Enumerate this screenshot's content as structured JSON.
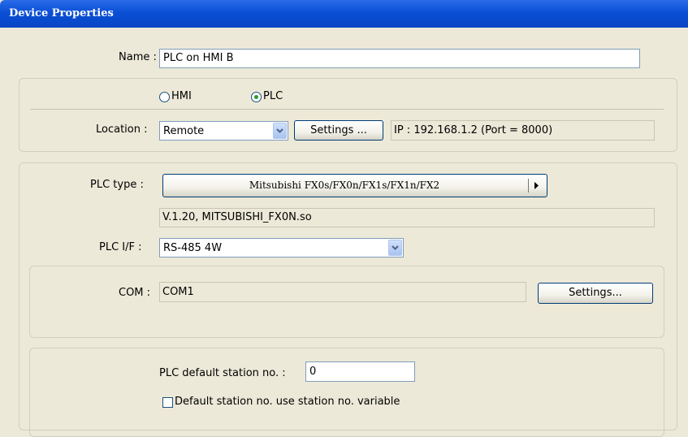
{
  "window": {
    "title": "Device Properties"
  },
  "name": {
    "label": "Name :",
    "value": "PLC on HMI B"
  },
  "target": {
    "hmi_label": "HMI",
    "plc_label": "PLC",
    "selected": "PLC"
  },
  "location": {
    "label": "Location :",
    "value": "Remote",
    "settings_label": "Settings ...",
    "ip_text": "IP : 192.168.1.2 (Port = 8000)"
  },
  "plc": {
    "type_label": "PLC type :",
    "type_value": "Mitsubishi FX0s/FX0n/FX1s/FX1n/FX2",
    "driver_text": "V.1.20, MITSUBISHI_FX0N.so",
    "if_label": "PLC I/F :",
    "if_value": "RS-485 4W"
  },
  "com": {
    "label": "COM :",
    "value": "COM1",
    "settings_label": "Settings..."
  },
  "station": {
    "label": "PLC default station no. :",
    "value": "0",
    "checkbox_label": "Default station no. use station no. variable",
    "checkbox_checked": false
  },
  "icons": {
    "dropdown": "chevron-down-icon",
    "submenu": "triangle-right-icon"
  }
}
